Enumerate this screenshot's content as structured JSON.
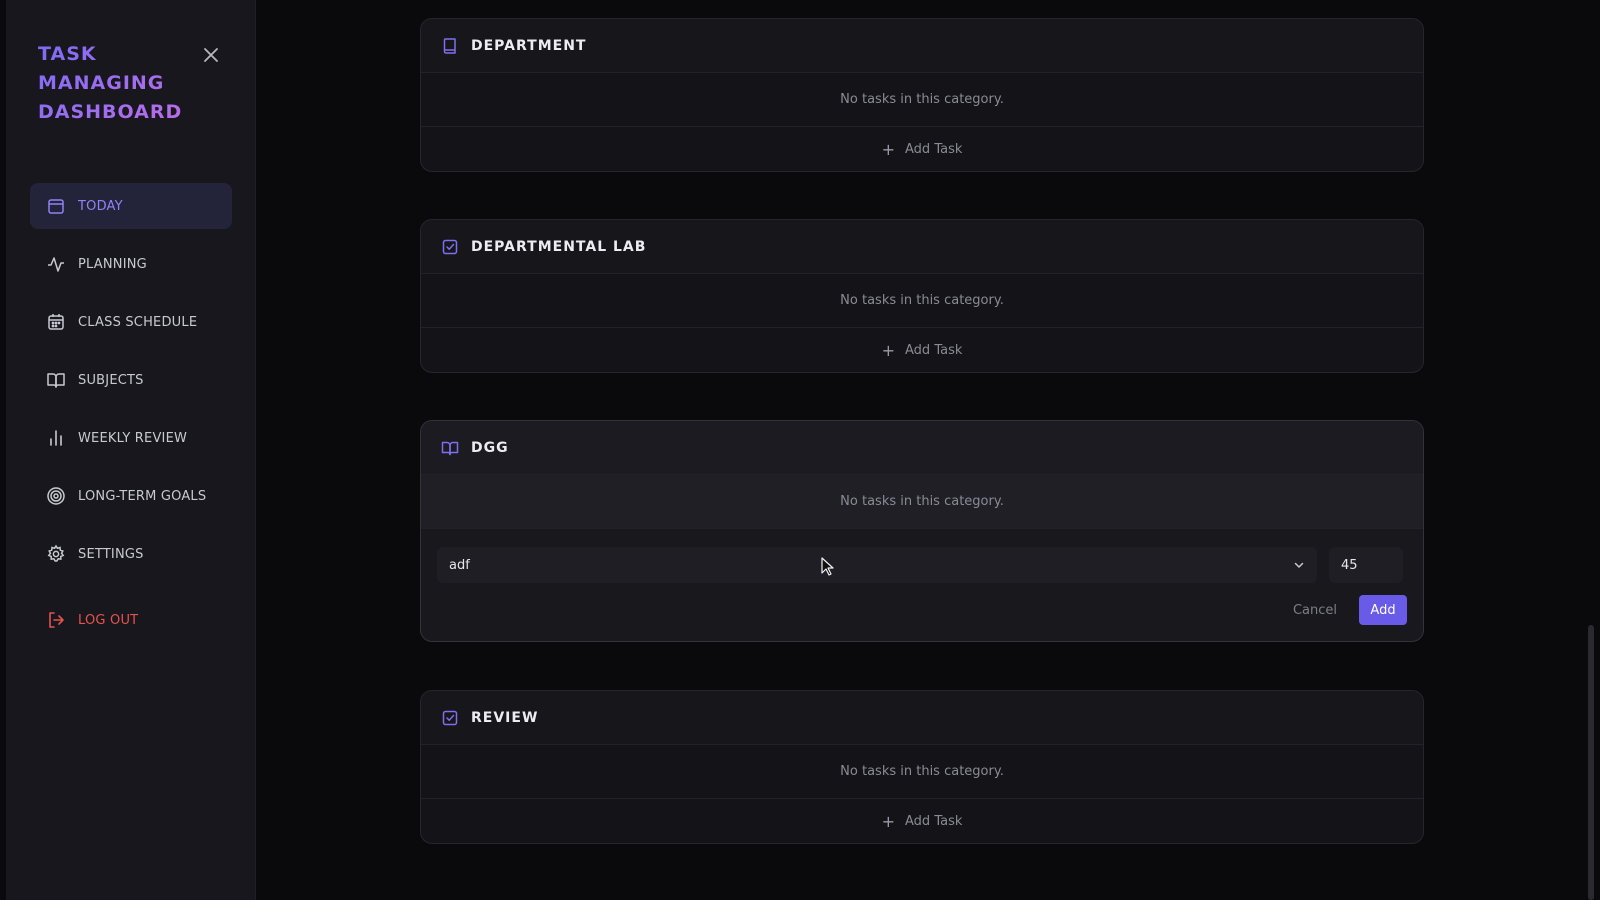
{
  "app": {
    "brand_lines": [
      "TASK",
      "MANAGING",
      "DASHBOARD"
    ]
  },
  "sidebar": {
    "items": [
      {
        "label": "TODAY",
        "icon": "calendar-icon",
        "active": true
      },
      {
        "label": "PLANNING",
        "icon": "activity-icon"
      },
      {
        "label": "CLASS SCHEDULE",
        "icon": "calendar-grid-icon"
      },
      {
        "label": "SUBJECTS",
        "icon": "book-open-icon"
      },
      {
        "label": "WEEKLY REVIEW",
        "icon": "bar-chart-icon"
      },
      {
        "label": "LONG-TERM GOALS",
        "icon": "target-icon"
      },
      {
        "label": "SETTINGS",
        "icon": "gear-icon"
      }
    ],
    "logout_label": "LOG OUT"
  },
  "categories": [
    {
      "title": "DEPARTMENT",
      "icon": "book-icon",
      "empty_text": "No tasks in this category.",
      "add_label": "Add Task"
    },
    {
      "title": "DEPARTMENTAL LAB",
      "icon": "checkbox-icon",
      "empty_text": "No tasks in this category.",
      "add_label": "Add Task"
    },
    {
      "title": "DGG",
      "icon": "book-open-icon",
      "empty_text": "No tasks in this category.",
      "form": {
        "selected_task": "adf",
        "duration_value": "45",
        "cancel_label": "Cancel",
        "add_label": "Add"
      }
    },
    {
      "title": "REVIEW",
      "icon": "checkbox-icon",
      "empty_text": "No tasks in this category.",
      "add_label": "Add Task"
    }
  ],
  "colors": {
    "accent": "#6a5ae8",
    "active_nav_text": "#8f83f7",
    "logout": "#e5534b"
  }
}
